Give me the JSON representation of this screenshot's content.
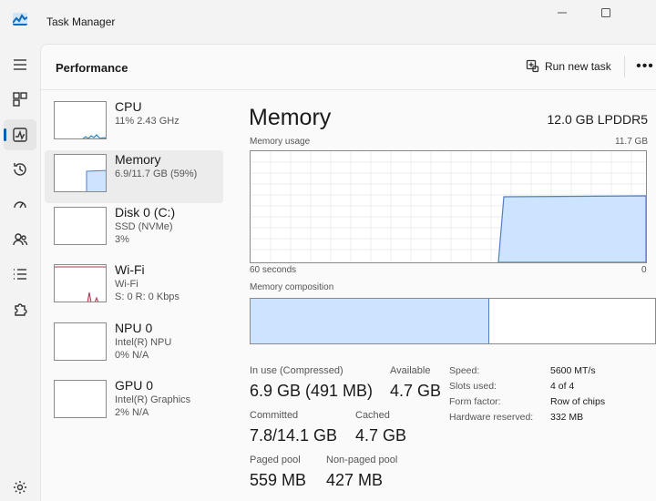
{
  "window": {
    "title": "Task Manager"
  },
  "header": {
    "title": "Performance",
    "run_task_label": "Run new task",
    "more_label": "•••"
  },
  "nav": {
    "items": [
      "menu",
      "processes",
      "performance",
      "app-history",
      "startup-apps",
      "users",
      "details",
      "services",
      "settings"
    ]
  },
  "perf_list": [
    {
      "name": "CPU",
      "lines": [
        "11%  2.43 GHz"
      ]
    },
    {
      "name": "Memory",
      "lines": [
        "6.9/11.7 GB (59%)"
      ]
    },
    {
      "name": "Disk 0 (C:)",
      "lines": [
        "SSD (NVMe)",
        "3%"
      ]
    },
    {
      "name": "Wi-Fi",
      "lines": [
        "Wi-Fi",
        "S: 0  R: 0 Kbps"
      ]
    },
    {
      "name": "NPU 0",
      "lines": [
        "Intel(R) NPU",
        "0% N/A"
      ]
    },
    {
      "name": "GPU 0",
      "lines": [
        "Intel(R) Graphics",
        "2% N/A"
      ]
    }
  ],
  "detail": {
    "title": "Memory",
    "spec": "12.0 GB LPDDR5",
    "usage_label": "Memory usage",
    "usage_max": "11.7 GB",
    "axis_left": "60 seconds",
    "axis_right": "0",
    "composition_label": "Memory composition",
    "composition_in_use_fraction": 0.59,
    "usage_history_fraction_end": 0.59
  },
  "stats": {
    "in_use_label": "In use (Compressed)",
    "in_use_value": "6.9 GB (491 MB)",
    "available_label": "Available",
    "available_value": "4.7 GB",
    "committed_label": "Committed",
    "committed_value": "7.8/14.1 GB",
    "cached_label": "Cached",
    "cached_value": "4.7 GB",
    "paged_label": "Paged pool",
    "paged_value": "559 MB",
    "nonpaged_label": "Non-paged pool",
    "nonpaged_value": "427 MB"
  },
  "specs": [
    {
      "label": "Speed:",
      "value": "5600 MT/s"
    },
    {
      "label": "Slots used:",
      "value": "4 of 4"
    },
    {
      "label": "Form factor:",
      "value": "Row of chips"
    },
    {
      "label": "Hardware reserved:",
      "value": "332 MB"
    }
  ],
  "colors": {
    "memory_fill": "#cce4ff",
    "memory_line": "#4f7fc4",
    "wifi_line": "#a8394f",
    "cpu_line": "#1f7ab8",
    "accent": "#005fb8"
  }
}
